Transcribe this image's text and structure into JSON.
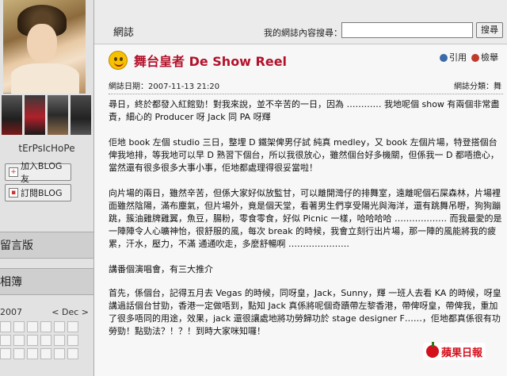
{
  "sidebar": {
    "username": "tErPsIcHoPe",
    "add_blog_friend_label": "加入BLOG友",
    "subscribe_blog_label": "訂閱BLOG",
    "guestbook_label": "留言版",
    "album_label": "相簿",
    "calendar": {
      "year": "2007",
      "prev": "<",
      "month": "Dec",
      "next": ">"
    }
  },
  "header": {
    "title": "網誌",
    "search_label": "我的網誌內容搜尋：",
    "search_value": "",
    "search_button": "搜尋"
  },
  "post": {
    "title": "舞台皇者 De Show Reel",
    "quote_label": "引用",
    "report_label": "檢舉",
    "date_label": "網誌日期：2007-11-13 21:20",
    "category_label": "網誌分類：舞",
    "paragraphs": [
      "尋日，終於都發入紅館勁！對我來說，並不辛苦的一日，因為 ………… 我地呢個 show 有兩個非常盡責，細心的 Producer 呀 Jack 同 PA 呀輝",
      "佢地 book 左個 studio 三日，整埋 D 鐵架俾男仔試 純真 medley，又 book 左個片場，特登搭個台俾我地排，等我地可以早 D 熟習下個台，所以我很放心，雖然個台好多機關，但係我一 D 都唔擔心，當然還有很多很多大事小事，佢地都處理得很妥當啦！",
      "向片場的兩日，雖然辛苦，但係大家好似放監甘，可以離開灣仔的排舞室，遠離呢個石屎森林，片場裡面雖然陰陽，滿布塵氣，但片場外，竟是個天堂，看著男生們享受陽光與海洋，還有跳舞吊嘢，狗狗蹦跳，簇油雞牌雞翼，魚豆，腸粉，零食零食，好似 Picnic 一樣，哈哈哈哈 ……………… 而我最愛的是一陣陣令人心曠神怡，很舒服的風，每次 break 的時候，我會立刻行出片場，那一陣的風能將我的疲累，汗水，壓力，不滿 通通吹走，多麼舒暢啊 …………………",
      "講番個演唱會，有三大推介",
      "首先，係個台，記得五月去 Vegas 的時候，同呀皇，Jack，Sunny，輝 一班人去看 KA 的時候，呀皇講過話個台甘勁，香港一定做唔到，點知 Jack 真係將呢個奇蹟帶左黎香港，帶俾呀皇，帶俾我，重加了很多唔同的用途，效果，jack 還很讓處地將功勞歸功於 stage designer F……，佢地都真係很有功勞勁！點勁法？！？！到時大家咪知囉！"
    ]
  },
  "watermark": {
    "brand": "蘋果日報"
  }
}
